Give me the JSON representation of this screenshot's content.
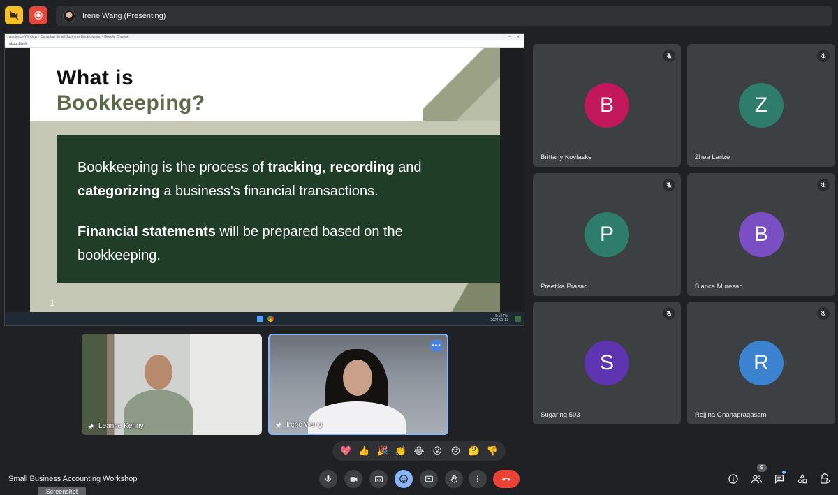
{
  "top_bar": {
    "presenting_label": "Irene Wang (Presenting)"
  },
  "shared_screen": {
    "window_title": "Audience Window - Canadian Small Business Bookkeeping - Google Chrome",
    "url": "about:blank",
    "slide": {
      "title_line1": "What is",
      "title_line2": "Bookkeeping?",
      "p1_a": "Bookkeeping is the process of ",
      "p1_b": "tracking",
      "p1_c": ", ",
      "p1_d": "recording",
      "p1_e": " and ",
      "p1_f": "categorizing",
      "p1_g": " a business's financial transactions.",
      "p2_a": "Financial statements",
      "p2_b": " will be prepared based on the bookkeeping.",
      "slide_number": "1"
    },
    "taskbar_time": "5:12 PM",
    "taskbar_date": "2024-03-13"
  },
  "cameras": [
    {
      "name": "Leanne Kenny"
    },
    {
      "name": "Irene Wang"
    }
  ],
  "participants": [
    {
      "initial": "B",
      "name": "Brittany Kovlaske",
      "color": "#c2185b"
    },
    {
      "initial": "Z",
      "name": "Zhea Larize",
      "color": "#2e7d6b"
    },
    {
      "initial": "P",
      "name": "Preetika Prasad",
      "color": "#2e7d6b"
    },
    {
      "initial": "B",
      "name": "Bianca Muresan",
      "color": "#7b4fc4"
    },
    {
      "initial": "S",
      "name": "Sugaring 503",
      "color": "#5e35b1"
    },
    {
      "initial": "R",
      "name": "Rejjina Gnanapragasam",
      "color": "#3b82d1"
    }
  ],
  "reactions": [
    "💖",
    "👍",
    "🎉",
    "👏",
    "😂",
    "😮",
    "😢",
    "🤔",
    "👎"
  ],
  "bottom_bar": {
    "meeting_title": "Small Business Accounting Workshop",
    "tooltip": "Screenshot",
    "people_count": "9"
  },
  "colors": {
    "background": "#202124",
    "tile": "#3c4043",
    "hangup": "#ea4335",
    "accent": "#8ab4f8"
  }
}
